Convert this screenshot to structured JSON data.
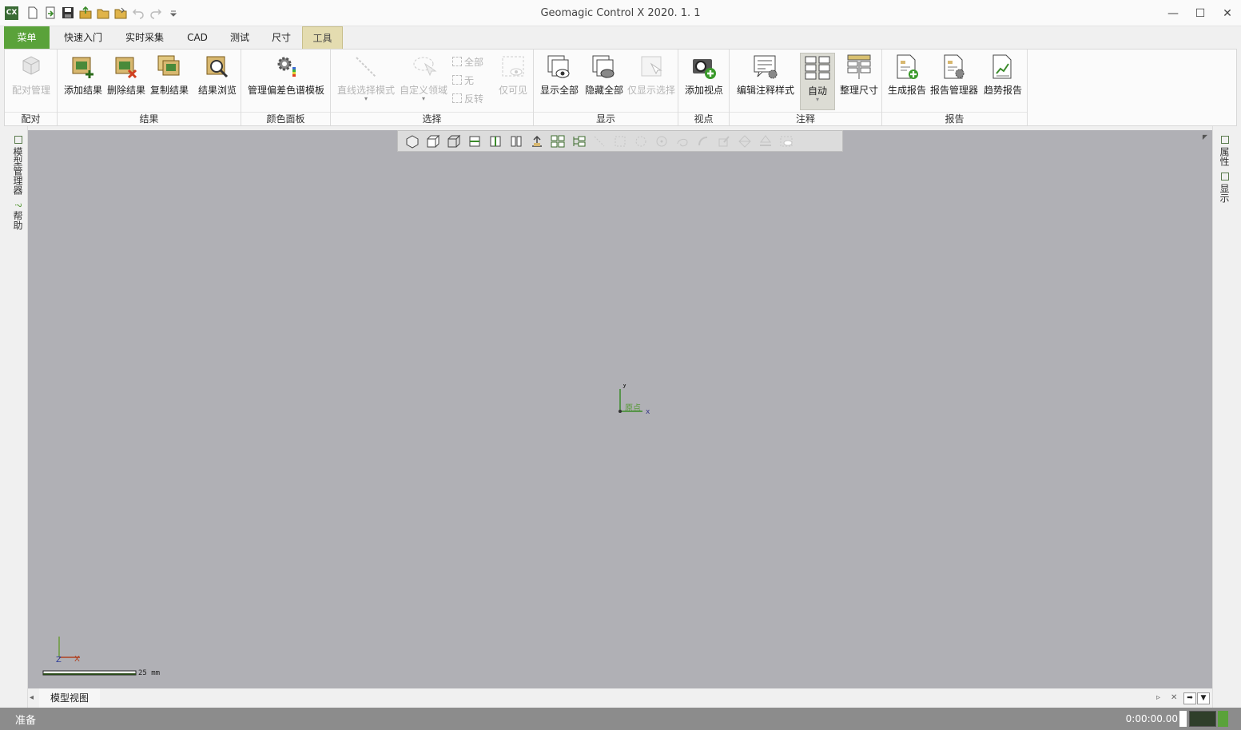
{
  "app": {
    "logo_text": "CX",
    "title": "Geomagic Control X 2020. 1. 1",
    "window_controls": {
      "minimize": "—",
      "maximize": "☐",
      "close": "✕"
    }
  },
  "quick_access": [
    "new-icon",
    "import-icon",
    "save-icon",
    "export-icon",
    "open-icon",
    "open-folder-icon",
    "undo-icon",
    "redo-icon",
    "customize-icon"
  ],
  "tabs": {
    "menu": "菜单",
    "quickstart": "快速入门",
    "realtime": "实时采集",
    "cad": "CAD",
    "measure": "测试",
    "dimension": "尺寸",
    "tools": "工具"
  },
  "ribbon": {
    "groups": {
      "alignment": "配对",
      "results": "结果",
      "color_panel": "颜色面板",
      "selection": "选择",
      "display": "显示",
      "view": "视点",
      "annotation": "注释",
      "report": "报告"
    },
    "buttons": {
      "alignment_manager": "配对管理",
      "add_result": "添加结果",
      "delete_result": "删除结果",
      "copy_result": "复制结果",
      "browse_result": "结果浏览",
      "color_template": "管理偏差色谱模板",
      "line_select": "直线选择模式",
      "custom_region": "自定义领域",
      "select_all": "全部",
      "select_none": "无",
      "select_invert": "反转",
      "visible_only": "仅可见",
      "show_all": "显示全部",
      "hide_all": "隐藏全部",
      "show_selected": "仅显示选择",
      "add_viewpoint": "添加视点",
      "edit_annotation_style": "编辑注释样式",
      "auto": "自动",
      "arrange_dimension": "整理尺寸",
      "generate_report": "生成报告",
      "report_manager": "报告管理器",
      "trend_report": "趋势报告"
    }
  },
  "side_panels": {
    "left": [
      "模型管理器",
      "帮助"
    ],
    "right": [
      "属性",
      "显示"
    ]
  },
  "viewport": {
    "origin_label": "原点",
    "axis_y": "y",
    "axis_x": "x",
    "triad_z": "Z",
    "triad_x": "X",
    "scale_label": "25 mm"
  },
  "document_tab": "模型视图",
  "status": {
    "text": "准备",
    "time": "0:00:00.00"
  },
  "colors": {
    "accent_green": "#5aa23a",
    "tools_tab": "#e4dcb0",
    "viewport_bg": "#b0b0b5",
    "statusbar": "#8c8c8c"
  }
}
